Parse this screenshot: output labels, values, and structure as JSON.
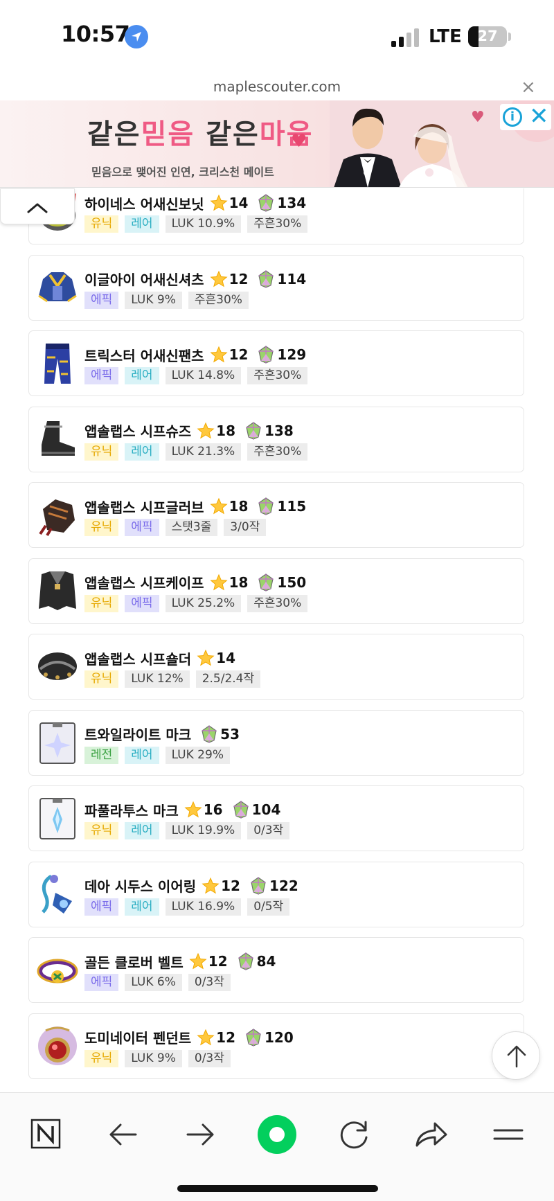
{
  "status_bar": {
    "time": "10:57",
    "network": "LTE",
    "battery": "27",
    "battery_level": 0.27
  },
  "browser": {
    "url": "maplescouter.com",
    "close_icon": "×"
  },
  "ad": {
    "headline_1a": "같은",
    "headline_1b": "믿음",
    "headline_2a": "같은",
    "headline_2b": "마음",
    "heart": "♥",
    "subline": "믿음으로 맺어진 인연, 크리스천 메이트",
    "info_label": "i",
    "close_label": "✕",
    "colors": {
      "pink": "#ef5a84",
      "info": "#1aa3d8"
    }
  },
  "items": [
    {
      "name": "하이네스 어새신보닛",
      "star": "14",
      "flame": "134",
      "icon": "assassin-bonnet-icon",
      "tags": [
        {
          "type": "unique",
          "label": "유닉"
        },
        {
          "type": "rare",
          "label": "레어"
        },
        {
          "type": "stat",
          "label": "LUK 10.9%"
        },
        {
          "type": "stat",
          "label": "주흔30%"
        }
      ]
    },
    {
      "name": "이글아이 어새신셔츠",
      "star": "12",
      "flame": "114",
      "icon": "assassin-shirt-icon",
      "tags": [
        {
          "type": "epic",
          "label": "에픽"
        },
        {
          "type": "stat",
          "label": "LUK 9%"
        },
        {
          "type": "stat",
          "label": "주흔30%"
        }
      ]
    },
    {
      "name": "트릭스터 어새신팬츠",
      "star": "12",
      "flame": "129",
      "icon": "assassin-pants-icon",
      "tags": [
        {
          "type": "epic",
          "label": "에픽"
        },
        {
          "type": "rare",
          "label": "레어"
        },
        {
          "type": "stat",
          "label": "LUK 14.8%"
        },
        {
          "type": "stat",
          "label": "주흔30%"
        }
      ]
    },
    {
      "name": "앱솔랩스 시프슈즈",
      "star": "18",
      "flame": "138",
      "icon": "thief-shoes-icon",
      "tags": [
        {
          "type": "unique",
          "label": "유닉"
        },
        {
          "type": "rare",
          "label": "레어"
        },
        {
          "type": "stat",
          "label": "LUK 21.3%"
        },
        {
          "type": "stat",
          "label": "주흔30%"
        }
      ]
    },
    {
      "name": "앱솔랩스 시프글러브",
      "star": "18",
      "flame": "115",
      "icon": "thief-gloves-icon",
      "tags": [
        {
          "type": "unique",
          "label": "유닉"
        },
        {
          "type": "epic",
          "label": "에픽"
        },
        {
          "type": "stat",
          "label": "스탯3줄"
        },
        {
          "type": "stat",
          "label": "3/0작"
        }
      ]
    },
    {
      "name": "앱솔랩스 시프케이프",
      "star": "18",
      "flame": "150",
      "icon": "thief-cape-icon",
      "tags": [
        {
          "type": "unique",
          "label": "유닉"
        },
        {
          "type": "epic",
          "label": "에픽"
        },
        {
          "type": "stat",
          "label": "LUK 25.2%"
        },
        {
          "type": "stat",
          "label": "주흔30%"
        }
      ]
    },
    {
      "name": "앱솔랩스 시프숄더",
      "star": "14",
      "flame": null,
      "icon": "thief-shoulder-icon",
      "tags": [
        {
          "type": "unique",
          "label": "유닉"
        },
        {
          "type": "stat",
          "label": "LUK 12%"
        },
        {
          "type": "stat",
          "label": "2.5/2.4작"
        }
      ]
    },
    {
      "name": "트와일라이트 마크",
      "star": null,
      "flame": "53",
      "icon": "twilight-mark-icon",
      "tags": [
        {
          "type": "legend",
          "label": "레전"
        },
        {
          "type": "rare",
          "label": "레어"
        },
        {
          "type": "stat",
          "label": "LUK 29%"
        }
      ]
    },
    {
      "name": "파풀라투스 마크",
      "star": "16",
      "flame": "104",
      "icon": "papulatus-mark-icon",
      "tags": [
        {
          "type": "unique",
          "label": "유닉"
        },
        {
          "type": "rare",
          "label": "레어"
        },
        {
          "type": "stat",
          "label": "LUK 19.9%"
        },
        {
          "type": "stat",
          "label": "0/3작"
        }
      ]
    },
    {
      "name": "데아 시두스 이어링",
      "star": "12",
      "flame": "122",
      "icon": "dea-sidus-earring-icon",
      "tags": [
        {
          "type": "epic",
          "label": "에픽"
        },
        {
          "type": "rare",
          "label": "레어"
        },
        {
          "type": "stat",
          "label": "LUK 16.9%"
        },
        {
          "type": "stat",
          "label": "0/5작"
        }
      ]
    },
    {
      "name": "골든 클로버 벨트",
      "star": "12",
      "flame": "84",
      "icon": "golden-clover-belt-icon",
      "tags": [
        {
          "type": "epic",
          "label": "에픽"
        },
        {
          "type": "stat",
          "label": "LUK 6%"
        },
        {
          "type": "stat",
          "label": "0/3작"
        }
      ]
    },
    {
      "name": "도미네이터 펜던트",
      "star": "12",
      "flame": "120",
      "icon": "dominator-pendant-icon",
      "tags": [
        {
          "type": "unique",
          "label": "유닉"
        },
        {
          "type": "stat",
          "label": "LUK 9%"
        },
        {
          "type": "stat",
          "label": "0/3작"
        }
      ]
    }
  ],
  "toolbar": {
    "buttons": [
      "naver-home-icon",
      "back-arrow-icon",
      "forward-arrow-icon",
      "naver-green-dot-icon",
      "refresh-icon",
      "share-icon",
      "menu-icon"
    ],
    "accent": "#03cf5d"
  }
}
